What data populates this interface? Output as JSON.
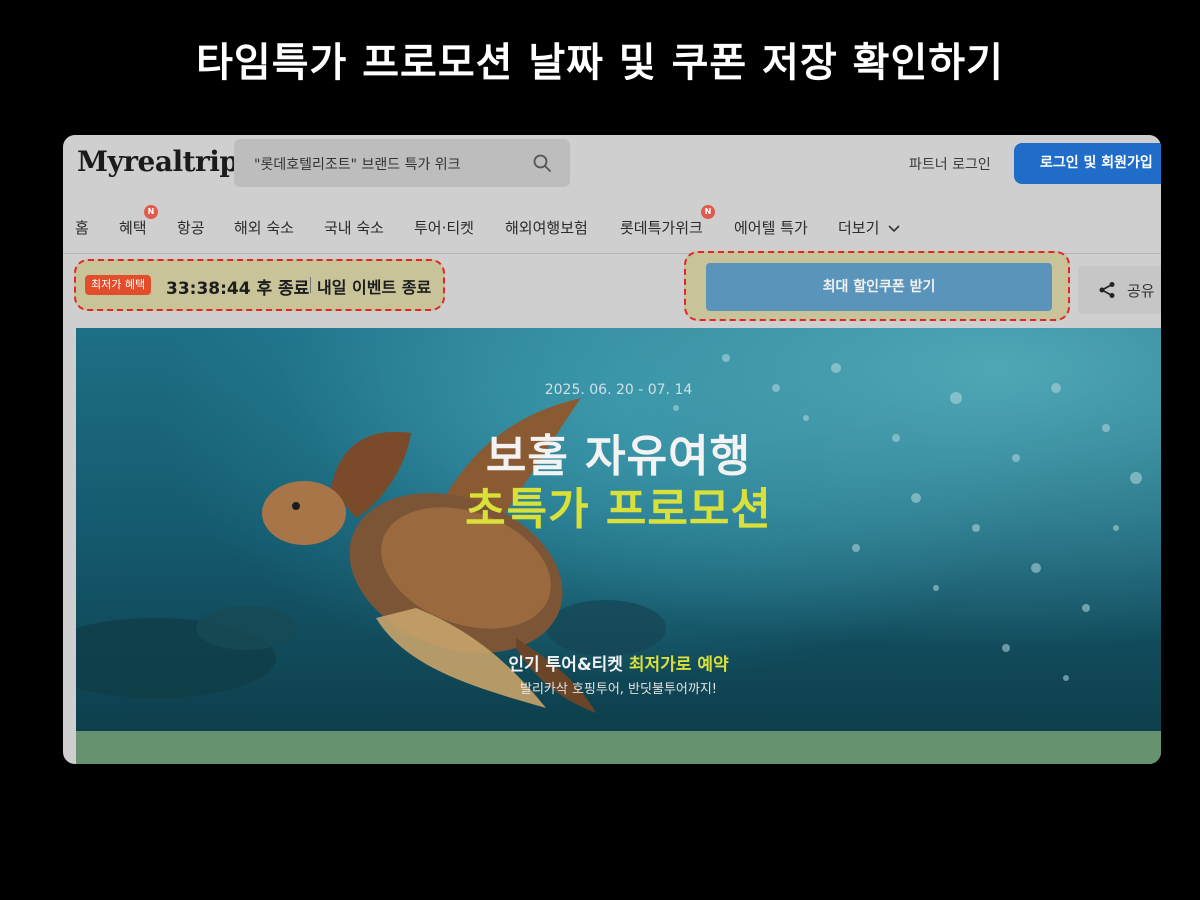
{
  "headline": "타임특가 프로모션 날짜 및 쿠폰 저장 확인하기",
  "header": {
    "logo": "Myrealtrip",
    "search_text": "\"롯데호텔리조트\" 브랜드 특가 위크",
    "partner_login": "파트너 로그인",
    "login_signup": "로그인 및 회원가입"
  },
  "nav": {
    "items": [
      {
        "label": "홈",
        "badge": ""
      },
      {
        "label": "혜택",
        "badge": "N"
      },
      {
        "label": "항공",
        "badge": ""
      },
      {
        "label": "해외 숙소",
        "badge": ""
      },
      {
        "label": "국내 숙소",
        "badge": ""
      },
      {
        "label": "투어·티켓",
        "badge": ""
      },
      {
        "label": "해외여행보험",
        "badge": ""
      },
      {
        "label": "롯데특가위크",
        "badge": "N"
      },
      {
        "label": "에어텔 특가",
        "badge": ""
      },
      {
        "label": "더보기",
        "badge": ""
      }
    ]
  },
  "timer": {
    "tag": "최저가 혜택",
    "countdown": "33:38:44 후 종료",
    "tail": "내일 이벤트 종료"
  },
  "coupon_button": "최대 할인쿠폰 받기",
  "share_label": "공유",
  "banner": {
    "date": "2025. 06. 20 - 07. 14",
    "title_line1": "보홀 자유여행",
    "title_line2": "초특가 프로모션",
    "sub_prefix": "인기 투어&티켓 ",
    "sub_highlight": "최저가로 예약",
    "sub2": "발리카삭 호핑투어, 반딧불투어까지!"
  },
  "colors": {
    "accent_blue": "#1f6cc9",
    "coupon_blue": "#5b94bb",
    "badge_red": "#e25a4d",
    "highlight_yellow": "#d9e03a",
    "dashed_outline": "#e0262b"
  }
}
